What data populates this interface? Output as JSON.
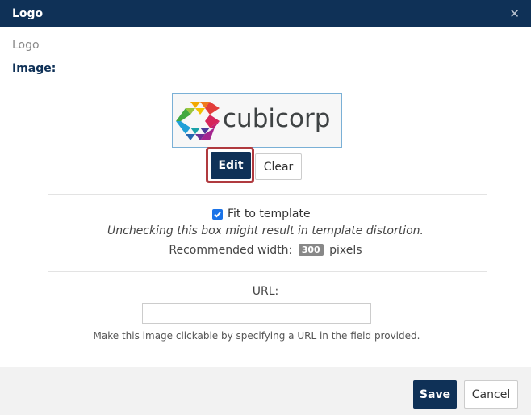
{
  "dialog": {
    "title": "Logo",
    "close_icon": "close-icon"
  },
  "breadcrumb": "Logo",
  "image_section": {
    "label": "Image:",
    "logo_text": "cubicorp",
    "edit_label": "Edit",
    "clear_label": "Clear"
  },
  "fit": {
    "label": "Fit to template",
    "checked": true,
    "warning": "Unchecking this box might result in template distortion.",
    "recommended_prefix": "Recommended width:",
    "recommended_value": "300",
    "recommended_unit": "pixels"
  },
  "url": {
    "label": "URL:",
    "value": "",
    "placeholder": "",
    "helper": "Make this image clickable by specifying a URL in the field provided."
  },
  "footer": {
    "save_label": "Save",
    "cancel_label": "Cancel"
  },
  "colors": {
    "header": "#0f3157",
    "highlight": "#b03a3f",
    "checkbox": "#1a73e8"
  }
}
